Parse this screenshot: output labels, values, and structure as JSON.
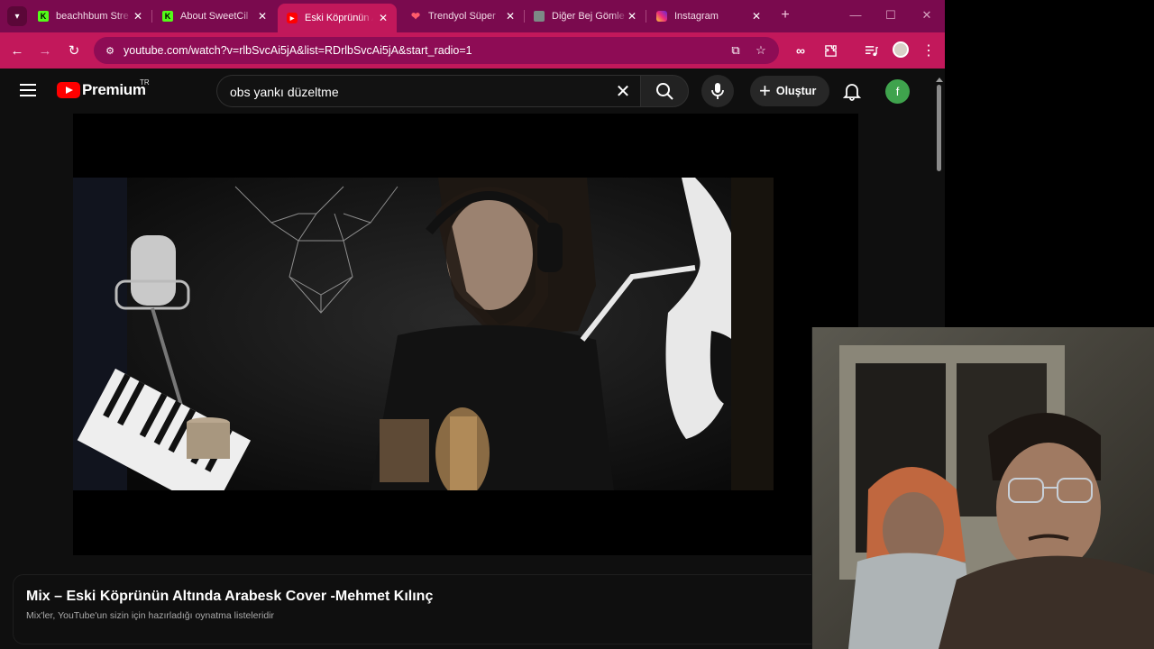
{
  "browser": {
    "tabs": [
      {
        "title": "beachhbum Stre",
        "favicon": "kick-icon",
        "color": "#53fc18",
        "active": false
      },
      {
        "title": "About SweetCil",
        "favicon": "kick-icon",
        "color": "#53fc18",
        "active": false
      },
      {
        "title": "Eski Köprünün A",
        "favicon": "youtube-icon",
        "color": "#ff0000",
        "active": true
      },
      {
        "title": "Trendyol Süper",
        "favicon": "heart-icon",
        "color": "#f27a1a",
        "active": false
      },
      {
        "title": "Diğer Bej Gömle",
        "favicon": "person-icon",
        "color": "#9aa0a6",
        "active": false
      },
      {
        "title": "Instagram",
        "favicon": "instagram-icon",
        "color": "#d6249f",
        "active": false
      }
    ],
    "url": "youtube.com/watch?v=rlbSvcAi5jA&list=RDrlbSvcAi5jA&start_radio=1",
    "accent": "#c2185b"
  },
  "youtube": {
    "brand": "Premium",
    "region": "TR",
    "search_query": "obs yankı düzeltme",
    "create_label": "Oluştur",
    "avatar_letter": "f"
  },
  "video": {
    "title": "Mix – Eski Köprünün Altında Arabesk Cover -Mehmet Kılınç",
    "subtitle": "Mix'ler, YouTube'un sizin için hazırladığı oynatma listeleridir"
  }
}
